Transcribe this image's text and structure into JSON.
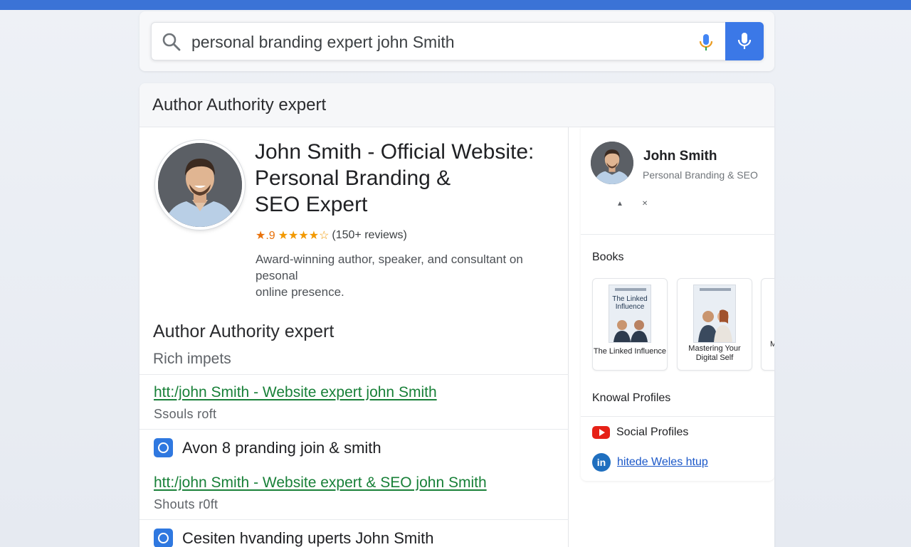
{
  "search": {
    "query": "personal branding expert john Smith",
    "icon": "search-icon",
    "voice_icon": "mic-icon"
  },
  "card": {
    "header_title": "Author Authority expert"
  },
  "result": {
    "title_line1": "John Smith - Official Website:",
    "title_line2": "Personal Branding &",
    "title_line3": "SEO Expert",
    "rating_value": "★.9",
    "stars": "★★★★☆",
    "reviews": "(150+ reviews)",
    "snippet_line1": "Award-winning author, speaker, and consultant on pesonal",
    "snippet_line2": "online presence."
  },
  "section": {
    "title": "Author Authority expert",
    "subtitle": "Rich impets"
  },
  "results": [
    {
      "link": "htt:/john Smith - Website expert john Smith",
      "sub": "Ssouls roft"
    },
    {
      "label": "Avon 8 pranding join & smith"
    },
    {
      "link": "htt:/john Smith - Website expert & SEO john Smith",
      "sub": "Shouts r0ft"
    },
    {
      "label": "Cesiten hvanding uperts John Smith"
    }
  ],
  "panel": {
    "name": "John Smith",
    "subtitle": "Personal Branding & SEO",
    "books_heading": "Books",
    "books": [
      {
        "cover_title": "The Linked Influence",
        "label": "The Linked Influence"
      },
      {
        "cover_title": "",
        "label": "Mastering Your Digital Self"
      },
      {
        "label": "M"
      }
    ],
    "profiles_heading": "Knowal Profiles",
    "social_label": "Social Profiles",
    "linkedin_link": "hitede Weles htup",
    "colors": {
      "youtube": "#e62117",
      "linkedin": "#1f6fbf",
      "accent": "#3b78e7"
    }
  }
}
